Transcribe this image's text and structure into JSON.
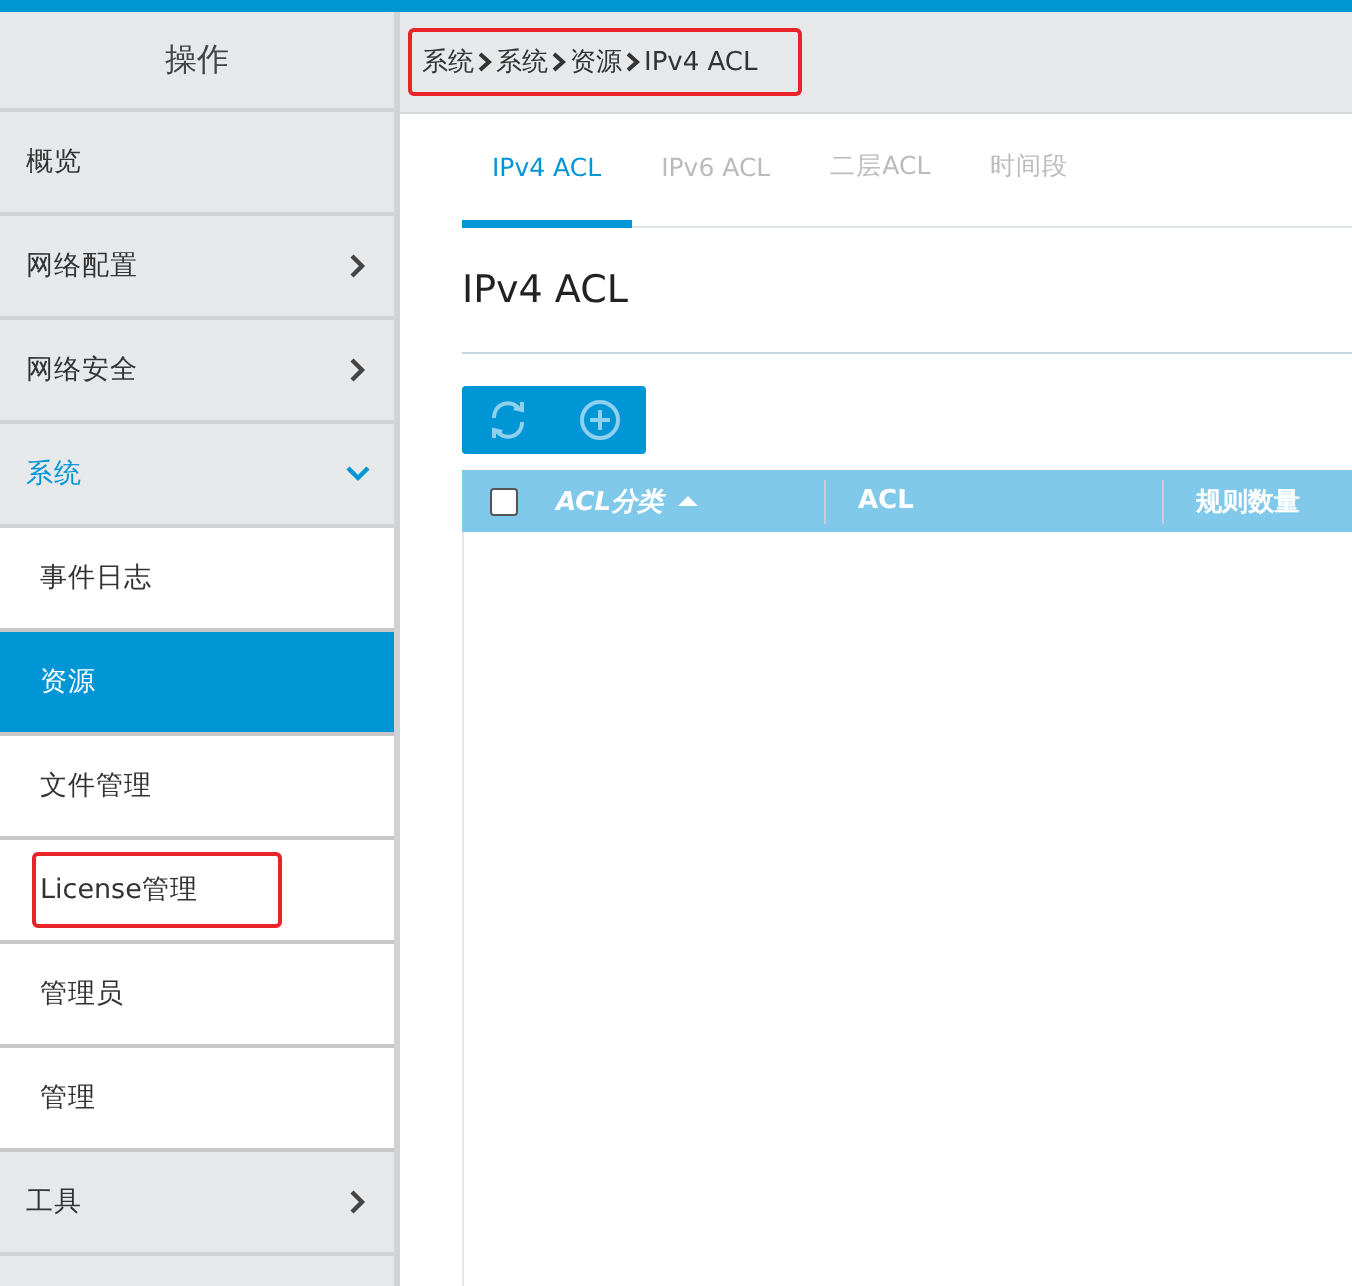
{
  "sidebar": {
    "title": "操作",
    "items": [
      {
        "label": "概览",
        "kind": "link",
        "selected": false
      },
      {
        "label": "网络配置",
        "kind": "group",
        "expanded": false,
        "selected": false
      },
      {
        "label": "网络安全",
        "kind": "group",
        "expanded": false,
        "selected": false
      },
      {
        "label": "系统",
        "kind": "group",
        "expanded": true,
        "selected": true,
        "children": [
          {
            "label": "事件日志",
            "selected": false,
            "highlighted": false
          },
          {
            "label": "资源",
            "selected": true,
            "highlighted": false
          },
          {
            "label": "文件管理",
            "selected": false,
            "highlighted": false
          },
          {
            "label": "License管理",
            "selected": false,
            "highlighted": true
          },
          {
            "label": "管理员",
            "selected": false,
            "highlighted": false
          },
          {
            "label": "管理",
            "selected": false,
            "highlighted": false
          }
        ]
      },
      {
        "label": "工具",
        "kind": "group",
        "expanded": false,
        "selected": false
      }
    ]
  },
  "breadcrumb": {
    "items": [
      "系统",
      "系统",
      "资源",
      "IPv4 ACL"
    ],
    "highlighted": true
  },
  "tabs": [
    {
      "label": "IPv4 ACL",
      "selected": true
    },
    {
      "label": "IPv6 ACL",
      "selected": false
    },
    {
      "label": "二层ACL",
      "selected": false
    },
    {
      "label": "时间段",
      "selected": false
    }
  ],
  "page_title": "IPv4 ACL",
  "table": {
    "select_all": {
      "checked": false
    },
    "columns": [
      {
        "label": "ACL分类",
        "sorted": true
      },
      {
        "label": "ACL",
        "sorted": false
      },
      {
        "label": "规则数量",
        "sorted": false
      }
    ]
  }
}
